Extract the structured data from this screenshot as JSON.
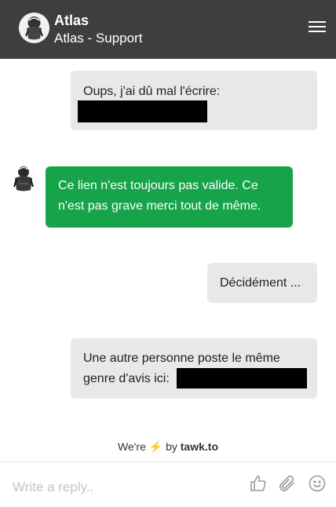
{
  "header": {
    "title": "Atlas",
    "subtitle": "Atlas - Support",
    "menu_icon": "hamburger-menu-icon",
    "avatar_icon": "atlas-statue-avatar"
  },
  "messages": [
    {
      "from": "visitor",
      "text": "Oups, j'ai dû mal l'écrire:",
      "redacted": true
    },
    {
      "from": "agent",
      "text": "Ce lien n'est toujours pas valide. Ce n'est pas grave merci tout de même."
    },
    {
      "from": "visitor",
      "text": "Décidément ..."
    },
    {
      "from": "visitor",
      "line1": "Une autre personne poste le même",
      "line2": "genre d'avis ici:",
      "redacted": true
    }
  ],
  "branding": {
    "prefix": "We're",
    "bolt": "⚡",
    "by": "by",
    "brand": "tawk.to"
  },
  "composer": {
    "placeholder": "Write a reply..",
    "tools": [
      "thumbs-up-icon",
      "paperclip-icon",
      "smiley-icon"
    ]
  },
  "colors": {
    "header_bg": "#3d3e3f",
    "agent_bubble": "#16a34a",
    "visitor_bubble": "#e8e8e8",
    "bolt": "#f5b800"
  }
}
